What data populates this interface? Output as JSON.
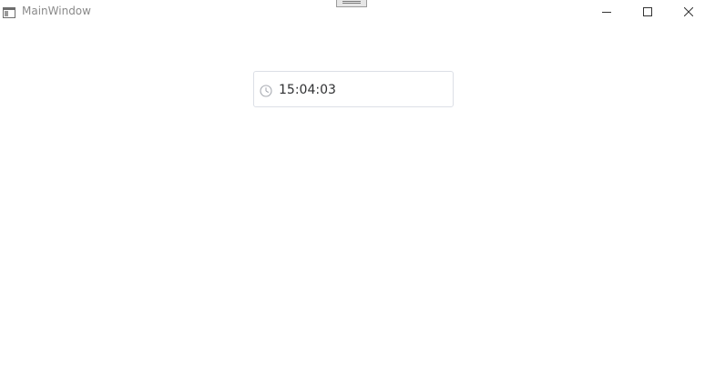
{
  "window": {
    "title": "MainWindow",
    "controls": {
      "minimize": "minimize-icon",
      "maximize": "maximize-icon",
      "close": "close-icon"
    }
  },
  "time_picker": {
    "value": "15:04:03",
    "icon": "clock-icon"
  },
  "colors": {
    "title_text": "#8a8a8a",
    "input_border": "#dcdfe6",
    "input_text": "#303133",
    "icon_gray": "#a8abb2"
  }
}
